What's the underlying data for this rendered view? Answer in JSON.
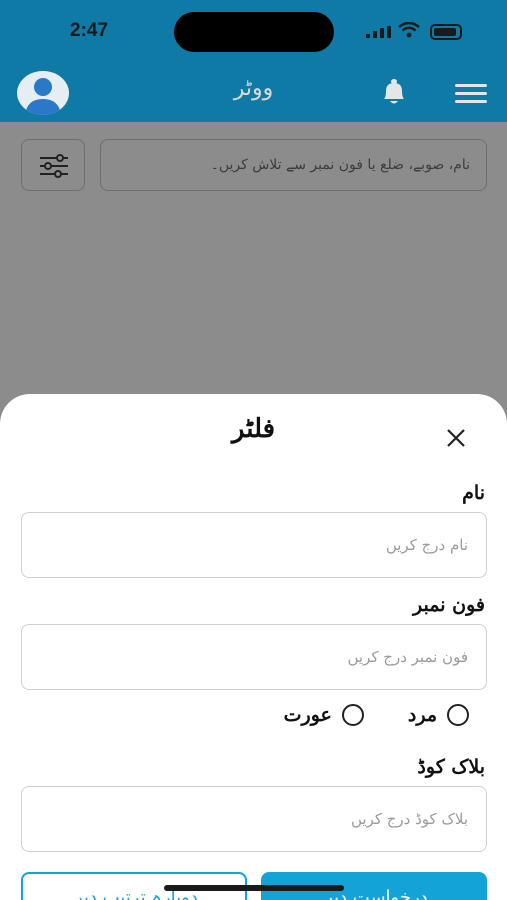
{
  "status_bar": {
    "time": "2:47"
  },
  "header": {
    "title": "ووٹر",
    "icons": {
      "avatar": "user-avatar-icon",
      "bell": "bell-icon",
      "menu": "hamburger-menu-icon"
    }
  },
  "search": {
    "placeholder": "نام، صوبے، ضلع یا فون نمبر سے تلاش کریں۔",
    "filter_icon": "sliders-icon"
  },
  "filter_sheet": {
    "title": "فلٹر",
    "close_icon": "close-icon",
    "name": {
      "label": "نام",
      "placeholder": "نام درج کریں",
      "value": ""
    },
    "phone": {
      "label": "فون نمبر",
      "placeholder": "فون نمبر درج کریں",
      "value": ""
    },
    "gender": {
      "options": [
        {
          "label": "مرد",
          "selected": false
        },
        {
          "label": "عورت",
          "selected": false
        }
      ]
    },
    "block_code": {
      "label": "بلاک کوڈ",
      "placeholder": "بلاک کوڈ درج کریں",
      "value": ""
    },
    "buttons": {
      "secondary": "دوبارہ ترتیب دیں",
      "primary": "درخواست دیں"
    }
  },
  "colors": {
    "header_bg": "#0f7aa6",
    "accent": "#14a3d6",
    "overlay": "#8c8c8c"
  }
}
